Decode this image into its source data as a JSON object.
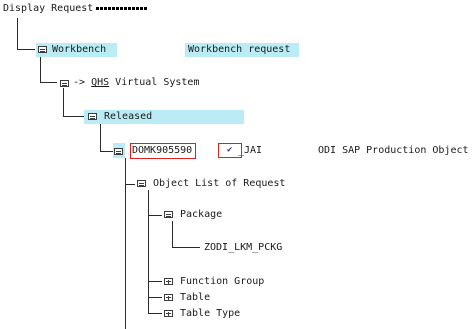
{
  "header": {
    "title": "Display Request"
  },
  "tree": {
    "workbench": {
      "label": "Workbench",
      "description": "Workbench request"
    },
    "system": {
      "arrow": "->",
      "code": "QHS",
      "suffix": "Virtual System"
    },
    "released": {
      "label": "Released"
    },
    "request": {
      "id": "DOMK905590",
      "owner_suffix": "_JAI",
      "check_mark": "✔",
      "description": "ODI SAP Production Object"
    },
    "object_list": {
      "label": "Object List of Request"
    },
    "package": {
      "label": "Package",
      "name": "ZODI_LKM_PCKG"
    },
    "items": [
      {
        "label": "Function Group"
      },
      {
        "label": "Table"
      },
      {
        "label": "Table Type"
      }
    ]
  },
  "icons": {
    "node": "folder-node-icon",
    "package": "package-node-icon"
  },
  "colors": {
    "highlight": "#b9ecf4",
    "redbox": "#d72323",
    "text": "#1a1a1a"
  }
}
